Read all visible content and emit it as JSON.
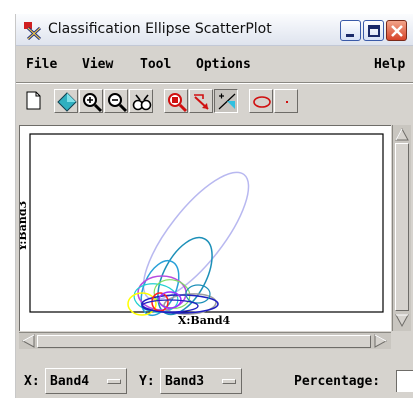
{
  "window": {
    "title": "Classification Ellipse ScatterPlot"
  },
  "menu": {
    "items": [
      "File",
      "View",
      "Tool",
      "Options"
    ],
    "help": "Help"
  },
  "toolbar": {
    "tools": [
      "new-page-icon",
      "pan-diamond-icon",
      "zoom-in-icon",
      "zoom-out-icon",
      "zoom-fit-icon",
      "zoom-select-icon",
      "select-arrow-icon",
      "slope-line-icon",
      "ellipse-icon",
      "point-icon"
    ]
  },
  "plot": {
    "xlabel": "X:Band4",
    "ylabel": "Y:Band3",
    "ellipse_colors": [
      "#b8b8f0",
      "#1c8fb8",
      "#b84ce0",
      "#28a0d8",
      "#20d0d0",
      "#80e060",
      "#ffff00",
      "#a0a0a0",
      "#2020c0",
      "#ff2020",
      "#9b30ff"
    ]
  },
  "controls": {
    "x_label": "X:",
    "x_value": "Band4",
    "y_label": "Y:",
    "y_value": "Band3",
    "percentage_label": "Percentage:"
  }
}
